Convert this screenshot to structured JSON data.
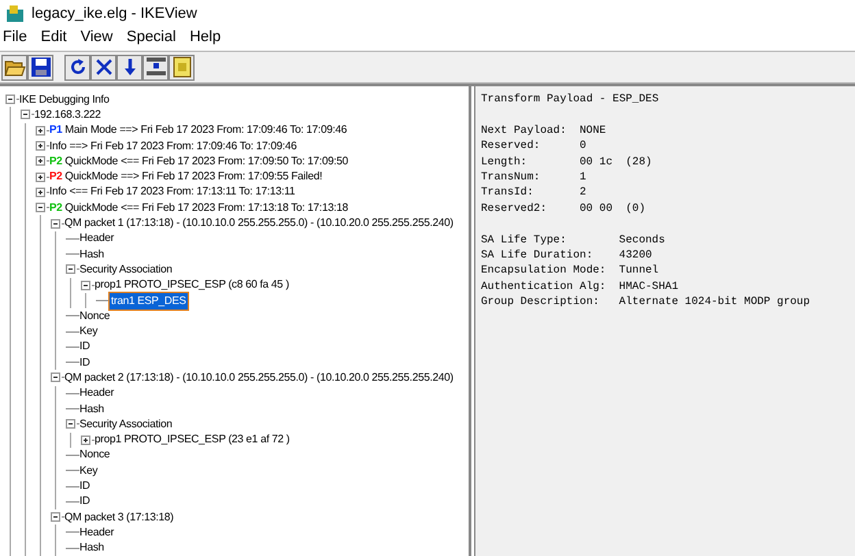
{
  "window": {
    "title": "legacy_ike.elg - IKEView"
  },
  "menu": [
    "File",
    "Edit",
    "View",
    "Special",
    "Help"
  ],
  "tree": [
    {
      "label": "IKE Debugging Info",
      "expanded": true,
      "selected": false,
      "children": [
        {
          "label": "192.168.3.222",
          "expanded": true,
          "selected": false,
          "children": [
            {
              "tag": "P1",
              "color": "#0a3cff",
              "label": "Main Mode   ==> Fri Feb 17 2023 From: 17:09:46 To: 17:09:46",
              "expanded": false,
              "selected": false
            },
            {
              "label": "Info   ==> Fri Feb 17 2023 From: 17:09:46 To: 17:09:46",
              "expanded": false,
              "selected": false
            },
            {
              "tag": "P2",
              "color": "#10c010",
              "label": "QuickMode   <== Fri Feb 17 2023 From: 17:09:50 To: 17:09:50",
              "expanded": false,
              "selected": false
            },
            {
              "tag": "P2",
              "color": "#ff1010",
              "label": "QuickMode   ==> Fri Feb 17 2023 From: 17:09:55 Failed!",
              "expanded": false,
              "selected": false
            },
            {
              "label": "Info   <== Fri Feb 17 2023 From: 17:13:11 To: 17:13:11",
              "expanded": false,
              "selected": false
            },
            {
              "tag": "P2",
              "color": "#10c010",
              "label": "QuickMode   <== Fri Feb 17 2023 From: 17:13:18 To: 17:13:18",
              "expanded": true,
              "selected": false,
              "children": [
                {
                  "label": "QM packet 1 (17:13:18) - (10.10.10.0  255.255.255.0) - (10.10.20.0  255.255.255.240)",
                  "expanded": true,
                  "selected": false,
                  "children": [
                    {
                      "label": "Header",
                      "selected": false
                    },
                    {
                      "label": "Hash",
                      "selected": false
                    },
                    {
                      "label": "Security Association",
                      "expanded": true,
                      "selected": false,
                      "children": [
                        {
                          "label": "prop1 PROTO_IPSEC_ESP  (c8 60 fa 45 )",
                          "expanded": true,
                          "selected": false,
                          "children": [
                            {
                              "label": "tran1 ESP_DES",
                              "selected": true
                            }
                          ]
                        }
                      ]
                    },
                    {
                      "label": "Nonce",
                      "selected": false
                    },
                    {
                      "label": "Key",
                      "selected": false
                    },
                    {
                      "label": "ID",
                      "selected": false
                    },
                    {
                      "label": "ID",
                      "selected": false
                    }
                  ]
                },
                {
                  "label": "QM packet 2 (17:13:18) - (10.10.10.0  255.255.255.0) - (10.10.20.0  255.255.255.240)",
                  "expanded": true,
                  "selected": false,
                  "children": [
                    {
                      "label": "Header",
                      "selected": false
                    },
                    {
                      "label": "Hash",
                      "selected": false
                    },
                    {
                      "label": "Security Association",
                      "expanded": true,
                      "selected": false,
                      "children": [
                        {
                          "label": "prop1 PROTO_IPSEC_ESP  (23 e1 af 72 )",
                          "expanded": false,
                          "selected": false
                        }
                      ]
                    },
                    {
                      "label": "Nonce",
                      "selected": false
                    },
                    {
                      "label": "Key",
                      "selected": false
                    },
                    {
                      "label": "ID",
                      "selected": false
                    },
                    {
                      "label": "ID",
                      "selected": false
                    }
                  ]
                },
                {
                  "label": "QM packet 3 (17:13:18)",
                  "expanded": true,
                  "selected": false,
                  "children": [
                    {
                      "label": "Header",
                      "selected": false
                    },
                    {
                      "label": "Hash",
                      "selected": false
                    }
                  ]
                }
              ]
            }
          ]
        }
      ]
    }
  ],
  "details": {
    "title": "Transform Payload - ESP_DES",
    "groups": [
      [
        {
          "name": "Next Payload:",
          "value": "NONE"
        },
        {
          "name": "Reserved:",
          "value": "0"
        },
        {
          "name": "Length:",
          "value": "00 1c  (28)"
        },
        {
          "name": "TransNum:",
          "value": "1"
        },
        {
          "name": "TransId:",
          "value": "2"
        },
        {
          "name": "Reserved2:",
          "value": "00 00  (0)"
        }
      ],
      [
        {
          "name": "SA Life Type:",
          "value": "Seconds"
        },
        {
          "name": "SA Life Duration:",
          "value": "43200"
        },
        {
          "name": "Encapsulation Mode:",
          "value": "Tunnel"
        },
        {
          "name": "Authentication Alg:",
          "value": "HMAC-SHA1"
        },
        {
          "name": "Group Description:",
          "value": "Alternate 1024-bit MODP group"
        }
      ]
    ]
  }
}
